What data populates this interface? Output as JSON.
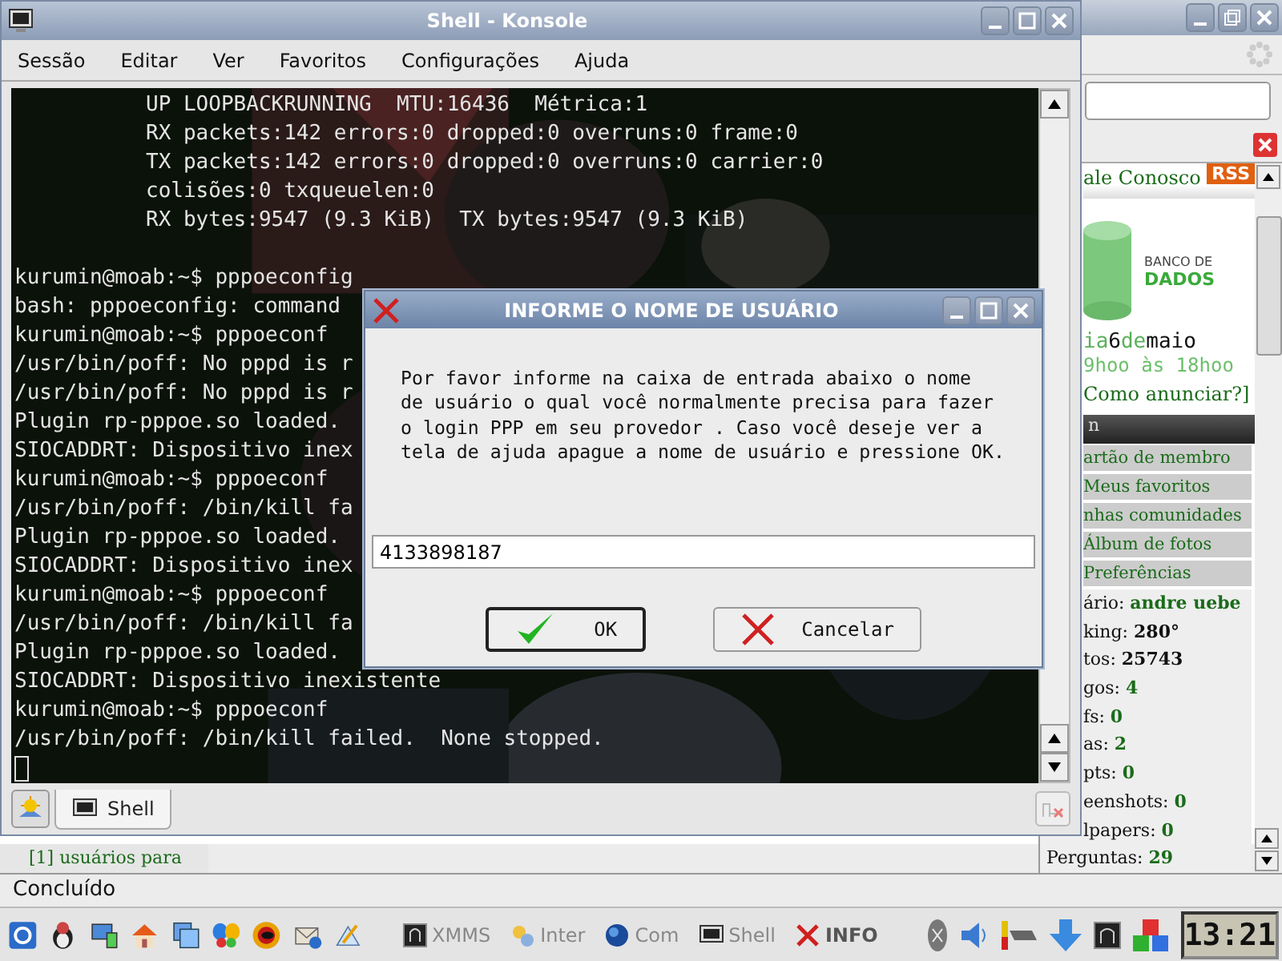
{
  "browser": {
    "header_link": "ale Conosco",
    "rss": "RSS",
    "banner": {
      "logo_lines": [
        "BANCO DE",
        "DADOS"
      ],
      "date": [
        {
          "text": "ia",
          "highlight": false
        },
        {
          "text": "6",
          "highlight": true
        },
        {
          "text": "de",
          "highlight": false
        },
        {
          "text": "maio",
          "highlight": true
        }
      ],
      "hours": "9hoo às 18hoo",
      "link": "Como anunciar?]"
    },
    "menu_title": "n",
    "menu": [
      "artão de membro",
      "Meus favoritos",
      "nhas comunidades",
      "Álbum de fotos",
      "Preferências"
    ],
    "stats": [
      {
        "label": "ário:",
        "value": "andre uebe",
        "kind": "link"
      },
      {
        "label": "king:",
        "value": "280°",
        "kind": "plain"
      },
      {
        "label": "tos:",
        "value": "25743",
        "kind": "plain"
      },
      {
        "label": "gos:",
        "value": "4",
        "kind": "link"
      },
      {
        "label": "fs:",
        "value": "0",
        "kind": "link"
      },
      {
        "label": "as:",
        "value": "2",
        "kind": "link"
      },
      {
        "label": "pts:",
        "value": "0",
        "kind": "link"
      },
      {
        "label": "eenshots:",
        "value": "0",
        "kind": "link"
      },
      {
        "label": "lpapers:",
        "value": "0",
        "kind": "link"
      },
      {
        "label": "Perguntas:",
        "value": "29",
        "kind": "link"
      }
    ],
    "users_link": "[1] usuários para"
  },
  "konsole": {
    "title": "Shell - Konsole",
    "menu": [
      "Sessão",
      "Editar",
      "Ver",
      "Favoritos",
      "Configurações",
      "Ajuda"
    ],
    "lines": [
      {
        "kind": "indented",
        "text": "UP LOOPBACKRUNNING  MTU:16436  Métrica:1"
      },
      {
        "kind": "indented",
        "text": "RX packets:142 errors:0 dropped:0 overruns:0 frame:0"
      },
      {
        "kind": "indented",
        "text": "TX packets:142 errors:0 dropped:0 overruns:0 carrier:0"
      },
      {
        "kind": "indented",
        "text": "colisões:0 txqueuelen:0"
      },
      {
        "kind": "indented",
        "text": "RX bytes:9547 (9.3 KiB)  TX bytes:9547 (9.3 KiB)"
      },
      {
        "kind": "blank"
      },
      {
        "kind": "plain",
        "text": "kurumin@moab:~$ pppoeconfig"
      },
      {
        "kind": "plain",
        "text": "bash: pppoeconfig: command"
      },
      {
        "kind": "plain",
        "text": "kurumin@moab:~$ pppoeconf"
      },
      {
        "kind": "plain",
        "text": "/usr/bin/poff: No pppd is r"
      },
      {
        "kind": "plain",
        "text": "/usr/bin/poff: No pppd is r"
      },
      {
        "kind": "plain",
        "text": "Plugin rp-pppoe.so loaded."
      },
      {
        "kind": "plain",
        "text": "SIOCADDRT: Dispositivo inex"
      },
      {
        "kind": "plain",
        "text": "kurumin@moab:~$ pppoeconf"
      },
      {
        "kind": "plain",
        "text": "/usr/bin/poff: /bin/kill fa"
      },
      {
        "kind": "plain",
        "text": "Plugin rp-pppoe.so loaded."
      },
      {
        "kind": "plain",
        "text": "SIOCADDRT: Dispositivo inex"
      },
      {
        "kind": "plain",
        "text": "kurumin@moab:~$ pppoeconf"
      },
      {
        "kind": "plain",
        "text": "/usr/bin/poff: /bin/kill fa"
      },
      {
        "kind": "plain",
        "text": "Plugin rp-pppoe.so loaded."
      },
      {
        "kind": "plain",
        "text": "SIOCADDRT: Dispositivo inexistente"
      },
      {
        "kind": "plain",
        "text": "kurumin@moab:~$ pppoeconf"
      },
      {
        "kind": "plain",
        "text": "/usr/bin/poff: /bin/kill failed.  None stopped."
      }
    ],
    "tabs": [
      {
        "label": "Shell",
        "selected": true
      }
    ]
  },
  "dialog": {
    "title": "INFORME O NOME DE USUÁRIO",
    "message_lines": [
      "Por favor informe na caixa de entrada abaixo o nome",
      "de usuário o qual você normalmente precisa para fazer",
      "o login PPP em seu provedor . Caso você deseje ver a",
      "tela de ajuda apague a nome de usuário e pressione OK."
    ],
    "value": "4133898187",
    "buttons": [
      {
        "label": "OK",
        "kind": "ok",
        "default": true
      },
      {
        "label": "Cancelar",
        "kind": "cancel",
        "default": false
      }
    ]
  },
  "status_bar": "Concluído",
  "taskbar": {
    "tasks": [
      {
        "label": "XMMS",
        "kind": "xmms",
        "selected": false
      },
      {
        "label": "Inter",
        "kind": "gears",
        "selected": false
      },
      {
        "label": "Com",
        "kind": "globe",
        "selected": false
      },
      {
        "label": "Shell",
        "kind": "shell",
        "selected": false
      },
      {
        "label": "INFO",
        "kind": "x",
        "selected": true
      }
    ],
    "clock": "13:21"
  }
}
